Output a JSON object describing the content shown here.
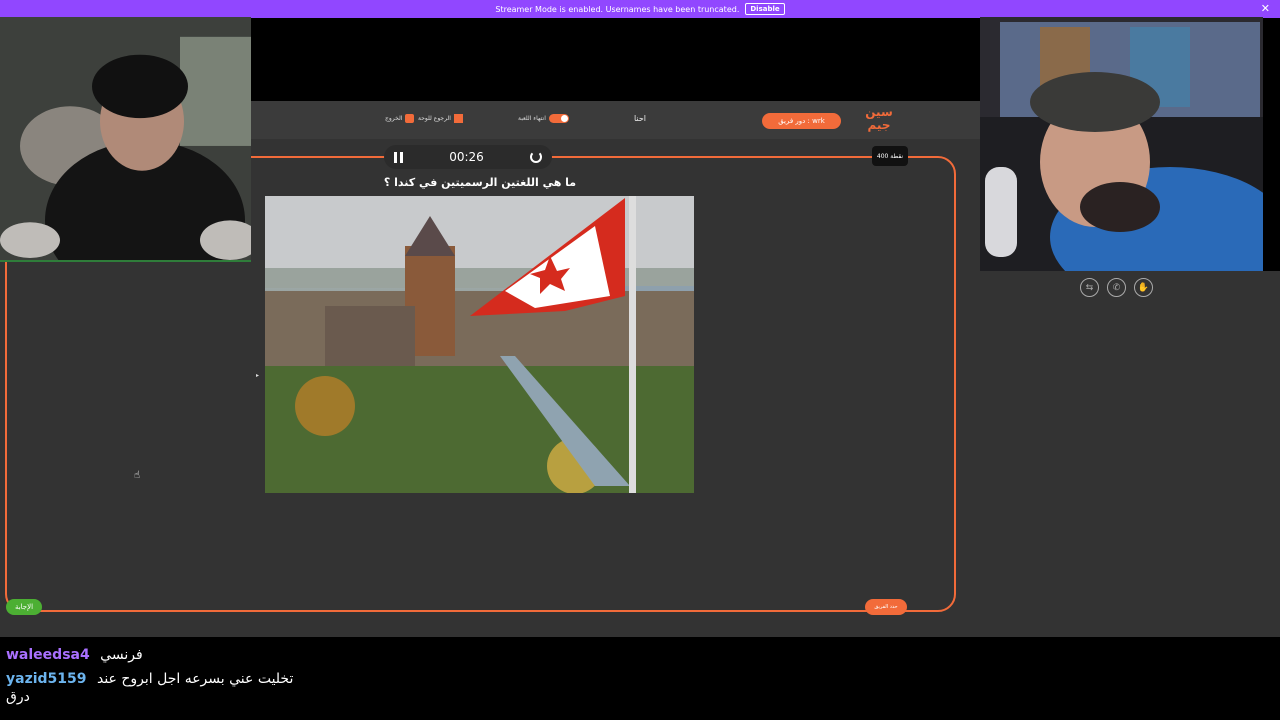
{
  "banner": {
    "text": "Streamer Mode is enabled. Usernames have been truncated.",
    "button": "Disable",
    "close": "✕"
  },
  "game": {
    "logo_top": "سين",
    "logo_bottom": "جيم",
    "team_pill": "دور فريق : wrk",
    "team_name": "احنا",
    "controls": {
      "end_game": "انتهاء اللعبة",
      "back_board": "الرجوع للوحة",
      "exit": "الخروج"
    },
    "timer": "00:26",
    "points": "400 نقطة",
    "question": "ما هي اللغتين الرسميتين في كندا ؟",
    "answer_button": "الإجابة",
    "orange_button": "حدد الفريق"
  },
  "chat": {
    "messages": [
      {
        "user": "waleedsa4",
        "user_color": "#a970ff",
        "text": "فرنسي"
      },
      {
        "user": "yazid5159",
        "user_color": "#6cb4ee",
        "text": "تخليت عني بسرعه اجل ابروح عند",
        "continuation": "درق"
      }
    ]
  },
  "colors": {
    "accent": "#f26b3a",
    "banner": "#9147ff",
    "green": "#4caf33"
  }
}
